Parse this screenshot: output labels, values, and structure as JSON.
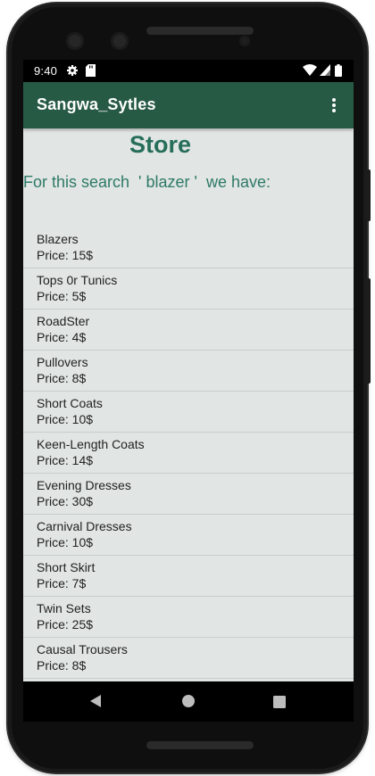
{
  "status_bar": {
    "time": "9:40",
    "icons": [
      "gear-icon",
      "sd-card-icon",
      "wifi-icon",
      "signal-icon",
      "battery-icon"
    ]
  },
  "app_bar": {
    "title": "Sangwa_Sytles",
    "menu_icon": "overflow-menu-icon"
  },
  "store": {
    "heading": "Store",
    "search_line": "For this search  ' blazer '  we have:"
  },
  "products": [
    {
      "name": "Blazers",
      "price": "Price: 15$"
    },
    {
      "name": "Tops 0r Tunics",
      "price": "Price: 5$"
    },
    {
      "name": "RoadSter",
      "price": "Price: 4$"
    },
    {
      "name": "Pullovers",
      "price": "Price: 8$"
    },
    {
      "name": "Short Coats",
      "price": "Price: 10$"
    },
    {
      "name": "Keen-Length Coats",
      "price": "Price: 14$"
    },
    {
      "name": "Evening Dresses",
      "price": "Price: 30$"
    },
    {
      "name": "Carnival Dresses",
      "price": "Price: 10$"
    },
    {
      "name": "Short Skirt",
      "price": "Price: 7$"
    },
    {
      "name": "Twin Sets",
      "price": "Price: 25$"
    },
    {
      "name": "Causal Trousers",
      "price": "Price: 8$"
    }
  ],
  "nav_bar": {
    "icons": [
      "back-icon",
      "home-icon",
      "recents-icon"
    ]
  },
  "colors": {
    "app_bar": "#275a45",
    "heading": "#266e5a",
    "screen_bg": "#e1e5e4"
  }
}
